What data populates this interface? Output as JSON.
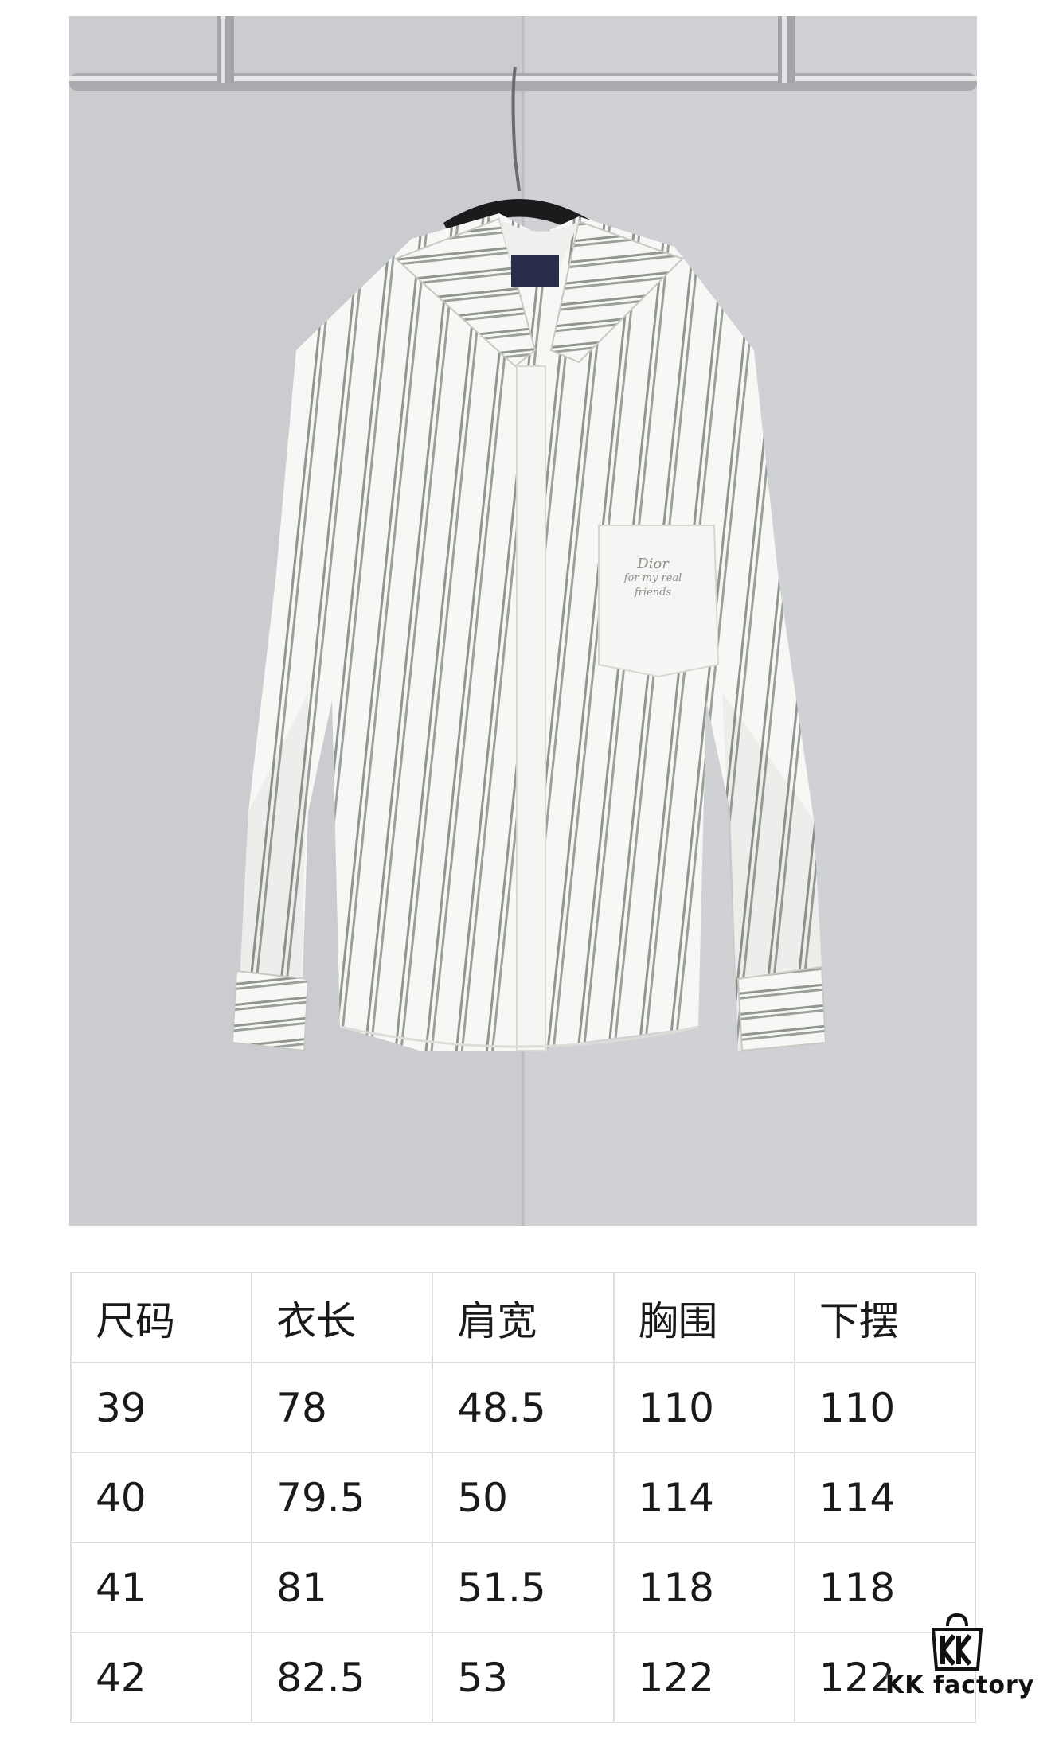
{
  "size_chart": {
    "headers": [
      "尺码",
      "衣长",
      "肩宽",
      "胸围",
      "下摆"
    ],
    "rows": [
      [
        "39",
        "78",
        "48.5",
        "110",
        "110"
      ],
      [
        "40",
        "79.5",
        "50",
        "114",
        "114"
      ],
      [
        "41",
        "81",
        "51.5",
        "118",
        "118"
      ],
      [
        "42",
        "82.5",
        "53",
        "122",
        "122"
      ]
    ]
  },
  "pocket_embroidery": {
    "brand": "Dior",
    "line2": "for my real",
    "line3": "friends"
  },
  "watermark": {
    "text": "KK factory",
    "icon": "kk-shopping-bag-logo"
  },
  "colors": {
    "stripe": "#8f958f",
    "shirt": "#f7f7f5",
    "wall": "#cdced1",
    "table_border": "#dcdcdc"
  }
}
